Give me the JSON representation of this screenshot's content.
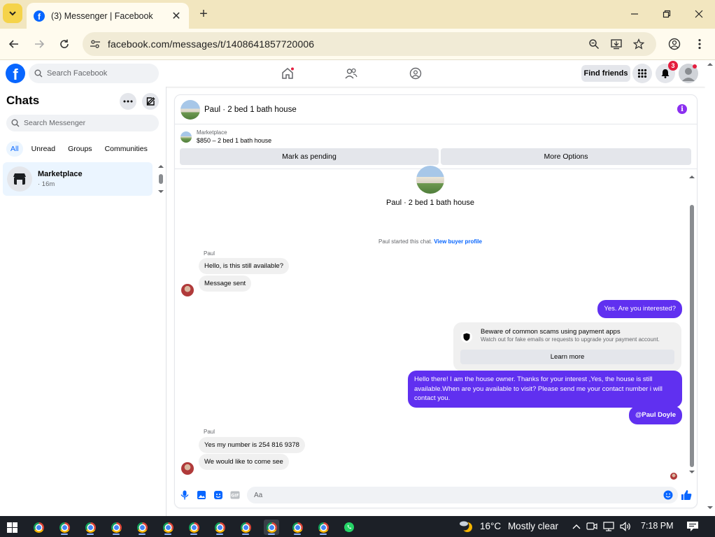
{
  "browser": {
    "tab_title": "(3) Messenger | Facebook",
    "url": "facebook.com/messages/t/1408641857720006"
  },
  "fb": {
    "search_placeholder": "Search Facebook",
    "find_friends": "Find friends",
    "notification_count": "3",
    "brand_color": "#0866ff"
  },
  "sidebar": {
    "title": "Chats",
    "search_placeholder": "Search Messenger",
    "filters": [
      "All",
      "Unread",
      "Groups",
      "Communities"
    ],
    "chat": {
      "name": "Marketplace",
      "time": "· 16m"
    }
  },
  "conversation": {
    "header_title": "Paul · 2 bed 1 bath house",
    "marketplace_label": "Marketplace",
    "listing": "$850 – 2 bed 1 bath house",
    "mark_pending": "Mark as pending",
    "more_options": "More Options",
    "thread_title": "Paul · 2 bed 1 bath house",
    "started_text": "Paul started this chat.",
    "view_buyer_profile": "View buyer profile",
    "messages": {
      "sender1": "Paul",
      "in1": "Hello, is this still available?",
      "in2": "Message sent",
      "out1": "Yes. Are you interested?",
      "scam_title": "Beware of common scams using payment apps",
      "scam_sub": "Watch out for fake emails or requests to upgrade your payment account.",
      "learn_more": "Learn more",
      "out2": "Hello there! I am the house owner. Thanks for your interest ,Yes, the house is still available.When are you available to visit? Please send me your contact number i will contact you.",
      "out3": "@Paul Doyle",
      "sender2": "Paul",
      "in3": "Yes my number is 254 816 9378",
      "in4": "We would like to come see"
    },
    "composer_placeholder": "Aa",
    "accent_color": "#6030f0"
  },
  "taskbar": {
    "temperature": "16°C",
    "weather": "Mostly clear",
    "time": "7:18 PM"
  }
}
